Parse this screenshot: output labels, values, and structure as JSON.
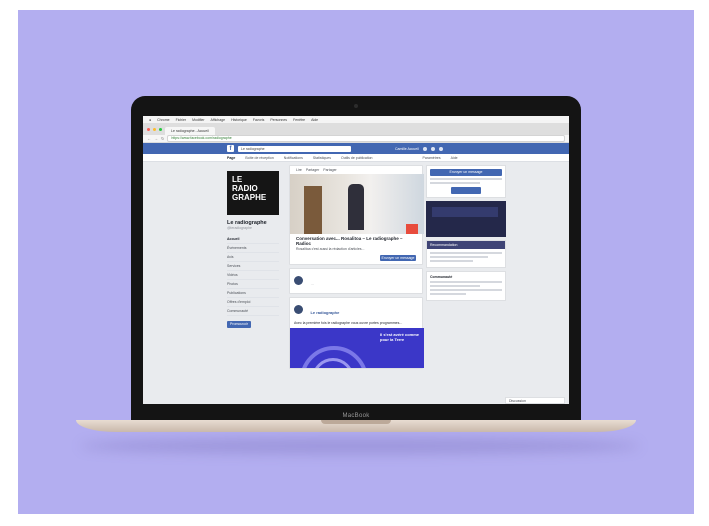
{
  "bezel": {
    "brand": "MacBook"
  },
  "menubar": {
    "items": [
      "Chrome",
      "Fichier",
      "Modifier",
      "Affichage",
      "Historique",
      "Favoris",
      "Personnes",
      "Fenêtre",
      "Aide"
    ]
  },
  "browser": {
    "tab_title": "Le radiographe - Accueil",
    "url": "https://www.facebook.com/radiographe"
  },
  "facebook": {
    "search_value": "Le radiographe",
    "user_label": "Camille  Accueil",
    "page_tabs": [
      "Page",
      "Boîte de réception",
      "Notifications",
      "Statistiques",
      "Outils de publication",
      "Paramètres",
      "Aide"
    ],
    "page_name": "Le radiographe",
    "page_handle": "@leradiographe",
    "cover_lines": [
      "LE",
      "RADIO",
      "GRAPHE"
    ],
    "side_links": [
      "Accueil",
      "Événements",
      "Avis",
      "Services",
      "Vidéos",
      "Photos",
      "Publications",
      "Offres d'emploi",
      "Communauté"
    ],
    "promote_label": "Promouvoir",
    "actions": [
      "Lire",
      "Partager",
      "Partager"
    ],
    "post_title": "Conversation avec... Rosalitoa – Le radiographe – Radioc",
    "post_text": "Rosalitoa c'est aussi la rédaction d'articles...",
    "send_label": "Envoyer un message",
    "post2_author": "Le radiographe",
    "post2_text": "Avec la première fois le radiographe vous ouvre portes programmes...",
    "image2_text": "Il s'est avéré comme pour la Terre",
    "cta_label": "Envoyer un message",
    "about_title": "Recommandation",
    "community_title": "Communauté",
    "chat_label": "Discussion"
  }
}
